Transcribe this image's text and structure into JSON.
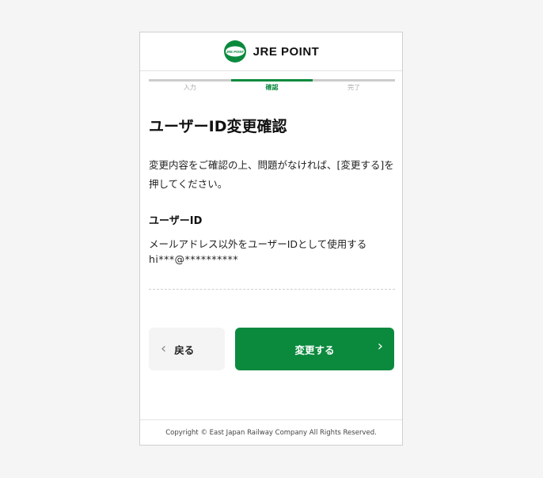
{
  "header": {
    "logo_text": "JRE POINT",
    "logo_icon": "jre-point-logo-icon",
    "brand_color": "#0b8a3e"
  },
  "steps": [
    {
      "label": "入力",
      "active": false
    },
    {
      "label": "確認",
      "active": true
    },
    {
      "label": "完了",
      "active": false
    }
  ],
  "main": {
    "title": "ユーザーID変更確認",
    "description": "変更内容をご確認の上、問題がなければ、[変更する]を押してください。",
    "section_label": "ユーザーID",
    "value_line1": "メールアドレス以外をユーザーIDとして使用する",
    "value_line2": "hi***@**********"
  },
  "buttons": {
    "back_label": "戻る",
    "back_icon": "chevron-left-icon",
    "change_label": "変更する",
    "change_icon": "chevron-right-icon"
  },
  "footer": {
    "copyright": "Copyright © East Japan Railway Company All Rights Reserved."
  }
}
